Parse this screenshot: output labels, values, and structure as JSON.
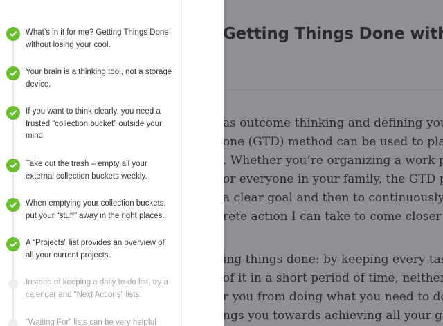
{
  "reader": {
    "title": "Getting Things Done without",
    "body_lines": [
      "as outcome thinking and defining your “next",
      "one (GTD) method can be used to plan",
      ".  Whether you’re organizing a work presen-",
      "or everyone in your family,  the GTD philoso",
      "a clear goal and then to continuously ask",
      "rete action I can take to come closer to",
      "",
      "ing things done:  by keeping every task sma",
      " of it in a short period of time,  neither lack o",
      "r you from doing what you need to do. And,",
      "ngs you towards achieving all your goals in"
    ],
    "toc_icon": "list-icon"
  },
  "sidebar": {
    "items": [
      {
        "text": "What’s in it for me? Getting Things Done without losing your cool.",
        "done": true
      },
      {
        "text": "Your brain is a thinking tool, not a storage device.",
        "done": true
      },
      {
        "text": "If you want to think clearly, you need a trusted “collection bucket” outside your mind.",
        "done": true
      },
      {
        "text": "Take out the trash – empty all your external collection buckets weekly.",
        "done": true
      },
      {
        "text": "When emptying your collection buckets, put your “stuff” away in the right places.",
        "done": true
      },
      {
        "text": "A “Projects” list provides an overview of all your current projects.",
        "done": true
      },
      {
        "text": "Instead of keeping a daily to-do list, try a calendar and “Next Actions” lists.",
        "done": false
      },
      {
        "text": "“Waiting For” lists can be very helpful when",
        "done": false
      }
    ],
    "colors": {
      "done": "#6abf2e",
      "pending": "#eeeeee"
    },
    "icons": {
      "done": "check-icon",
      "pending": "dot-icon"
    }
  }
}
